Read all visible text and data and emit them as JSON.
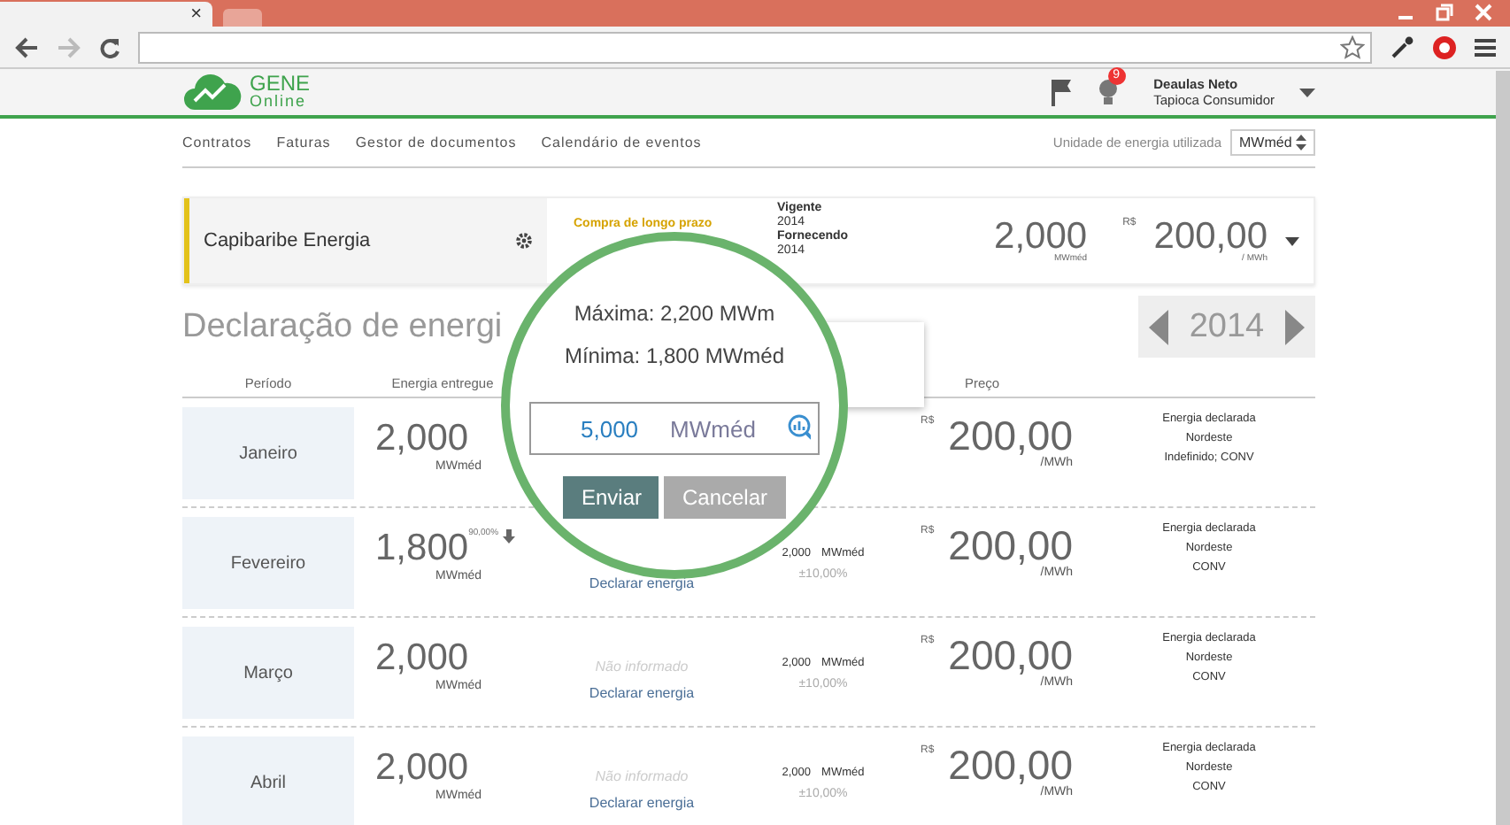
{
  "browser": {
    "tab_close": "×"
  },
  "header": {
    "logo_title": "GENE",
    "logo_subtitle": "Online",
    "notification_count": "9",
    "user_name": "Deaulas Neto",
    "user_role": "Tapioca Consumidor"
  },
  "nav": {
    "items": [
      "Contratos",
      "Faturas",
      "Gestor de documentos",
      "Calendário de eventos"
    ],
    "unit_label": "Unidade de energia utilizada",
    "unit_value": "MWméd"
  },
  "contract": {
    "name": "Capibaribe Energia",
    "type": "Compra de longo prazo",
    "periods": [
      {
        "label": "Vigente",
        "value": "2014"
      },
      {
        "label": "Fornecendo",
        "value": "2014"
      }
    ],
    "energy": "2,000",
    "energy_unit": "MWméd",
    "currency": "R$",
    "price": "200,00",
    "price_unit": "/ MWh"
  },
  "title": "Declaração de energi",
  "year": "2014",
  "columns": {
    "period": "Período",
    "delivered": "Energia entregue",
    "price": "Preço"
  },
  "rows": [
    {
      "month": "Janeiro",
      "delivered": "2,000",
      "delivered_unit": "MWméd",
      "currency": "R$",
      "price": "200,00",
      "price_unit": "/MWh",
      "status": "Energia declarada",
      "region": "Nordeste",
      "modality": "Indefinido; CONV"
    },
    {
      "month": "Fevereiro",
      "delivered": "1,800",
      "variation": "90,00%",
      "delivered_unit": "MWméd",
      "declare_link": "Declarar energia",
      "reference": "2,000",
      "reference_unit": "MWméd",
      "tolerance": "±10,00%",
      "currency": "R$",
      "price": "200,00",
      "price_unit": "/MWh",
      "status": "Energia declarada",
      "region": "Nordeste",
      "modality": "CONV"
    },
    {
      "month": "Março",
      "delivered": "2,000",
      "delivered_unit": "MWméd",
      "declared": "Não informado",
      "declare_link": "Declarar energia",
      "reference": "2,000",
      "reference_unit": "MWméd",
      "tolerance": "±10,00%",
      "currency": "R$",
      "price": "200,00",
      "price_unit": "/MWh",
      "status": "Energia declarada",
      "region": "Nordeste",
      "modality": "CONV"
    },
    {
      "month": "Abril",
      "delivered": "2,000",
      "delivered_unit": "MWméd",
      "declared": "Não informado",
      "declare_link": "Declarar energia",
      "reference": "2,000",
      "reference_unit": "MWméd",
      "tolerance": "±10,00%",
      "currency": "R$",
      "price": "200,00",
      "price_unit": "/MWh",
      "status": "Energia declarada",
      "region": "Nordeste",
      "modality": "CONV"
    }
  ],
  "magnifier": {
    "maximum": "Máxima: 2,200 MWm",
    "minimum": "Mínima: 1,800 MWméd",
    "value": "5,000",
    "unit": "MWméd",
    "buttons": [
      {
        "label": "Enviar",
        "kind": "primary"
      },
      {
        "label": "Cancelar",
        "kind": "secondary"
      }
    ]
  }
}
